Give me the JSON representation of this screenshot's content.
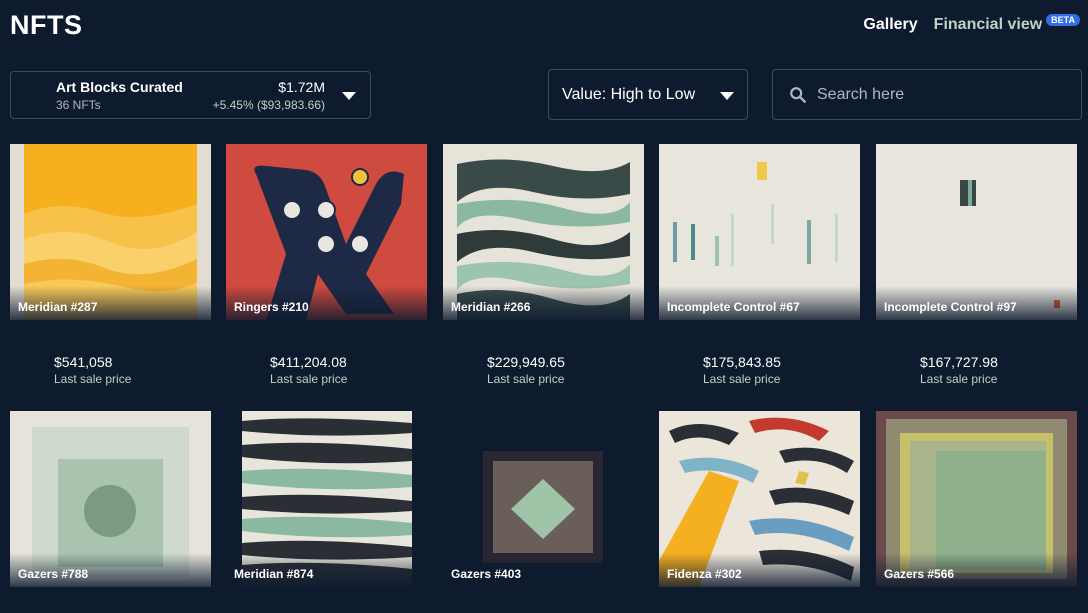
{
  "header": {
    "title": "NFTS",
    "nav": {
      "gallery": "Gallery",
      "financial": "Financial view",
      "badge": "BETA"
    }
  },
  "collection": {
    "name": "Art Blocks Curated",
    "count": "36 NFTs",
    "value": "$1.72M",
    "change": "+5.45% ($93,983.66)"
  },
  "sort": {
    "label": "Value: High to Low"
  },
  "search": {
    "placeholder": "Search here",
    "value": ""
  },
  "price_label": "Last sale price",
  "cards": [
    {
      "title": "Meridian #287",
      "price": "$541,058"
    },
    {
      "title": "Ringers #210",
      "price": "$411,204.08"
    },
    {
      "title": "Meridian #266",
      "price": "$229,949.65"
    },
    {
      "title": "Incomplete Control #67",
      "price": "$175,843.85"
    },
    {
      "title": "Incomplete Control #97",
      "price": "$167,727.98"
    },
    {
      "title": "Gazers #788"
    },
    {
      "title": "Meridian #874"
    },
    {
      "title": "Gazers #403"
    },
    {
      "title": "Fidenza #302"
    },
    {
      "title": "Gazers #566"
    }
  ],
  "colors": {
    "background": "#0e1a2e",
    "accent": "#b7d6c3",
    "badge": "#2f6ee4",
    "border": "#3c4b63"
  }
}
